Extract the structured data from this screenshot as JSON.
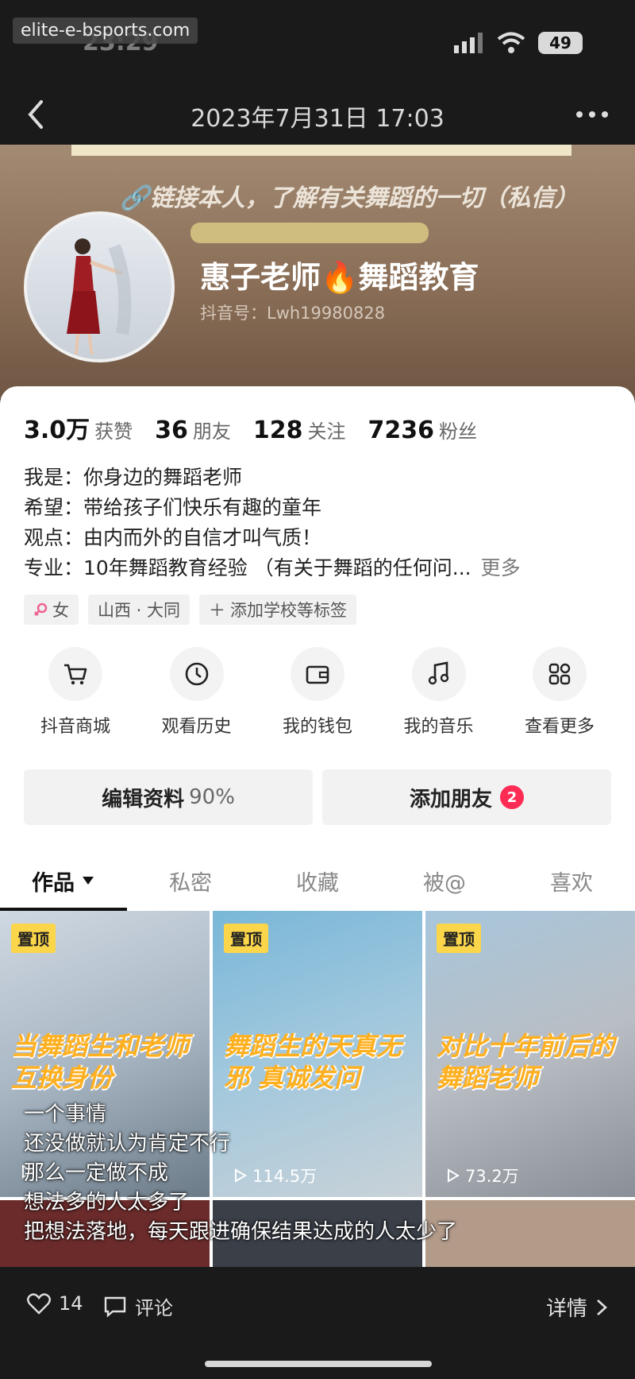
{
  "watermark": "elite-e-bsports.com",
  "status": {
    "time": "23:29",
    "battery": "49"
  },
  "header": {
    "title": "2023年7月31日 17:03"
  },
  "cover": {
    "slogan": "🔗链接本人，了解有关舞蹈的一切（私信）"
  },
  "profile": {
    "name": "惠子老师🔥舞蹈教育",
    "id": "抖音号：Lwh19980828"
  },
  "stats": [
    {
      "value": "3.0万",
      "label": "获赞"
    },
    {
      "value": "36",
      "label": "朋友"
    },
    {
      "value": "128",
      "label": "关注"
    },
    {
      "value": "7236",
      "label": "粉丝"
    }
  ],
  "bio": {
    "lines": [
      "我是：你身边的舞蹈老师",
      "希望：带给孩子们快乐有趣的童年",
      "观点：由内而外的自信才叫气质！",
      "专业：10年舞蹈教育经验 （有关于舞蹈的任何问..."
    ],
    "more": "更多"
  },
  "tags": {
    "gender": "女",
    "location": "山西 · 大同",
    "add": "添加学校等标签"
  },
  "shortcuts": [
    {
      "icon": "cart-icon",
      "label": "抖音商城"
    },
    {
      "icon": "clock-icon",
      "label": "观看历史"
    },
    {
      "icon": "wallet-icon",
      "label": "我的钱包"
    },
    {
      "icon": "music-note-icon",
      "label": "我的音乐"
    },
    {
      "icon": "grid-icon",
      "label": "查看更多"
    }
  ],
  "actions": {
    "edit": "编辑资料",
    "edit_pct": "90%",
    "add_friend": "添加朋友",
    "friend_badge": "2"
  },
  "tabs": [
    "作品",
    "私密",
    "收藏",
    "被@",
    "喜欢"
  ],
  "videos": [
    {
      "pin": "置顶",
      "caption": "当舞蹈生和老师互换身份",
      "plays": ""
    },
    {
      "pin": "置顶",
      "caption": "舞蹈生的天真无邪 真诚发问",
      "plays": "114.5万"
    },
    {
      "pin": "置顶",
      "caption": "对比十年前后的舞蹈老师",
      "plays": "73.2万"
    }
  ],
  "overlay_text": [
    "一个事情",
    "还没做就认为肯定不行",
    "那么一定做不成",
    "想法多的人太多了",
    "把想法落地，每天跟进确保结果达成的人太少了"
  ],
  "footer": {
    "likes": "14",
    "comment": "评论",
    "detail": "详情"
  }
}
